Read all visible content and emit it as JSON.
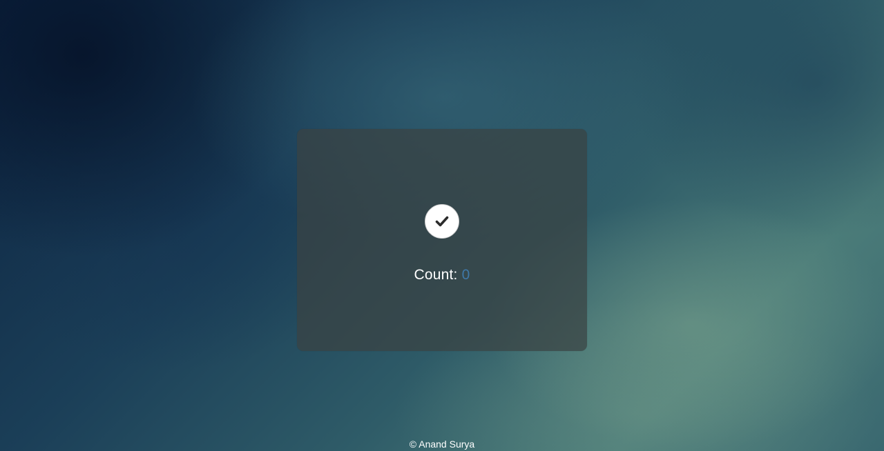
{
  "counter": {
    "label": "Count:",
    "value": "0",
    "value_color": "#3f78a8",
    "button_icon": "checkmark-icon"
  },
  "footer": {
    "text": "© Anand Surya"
  }
}
